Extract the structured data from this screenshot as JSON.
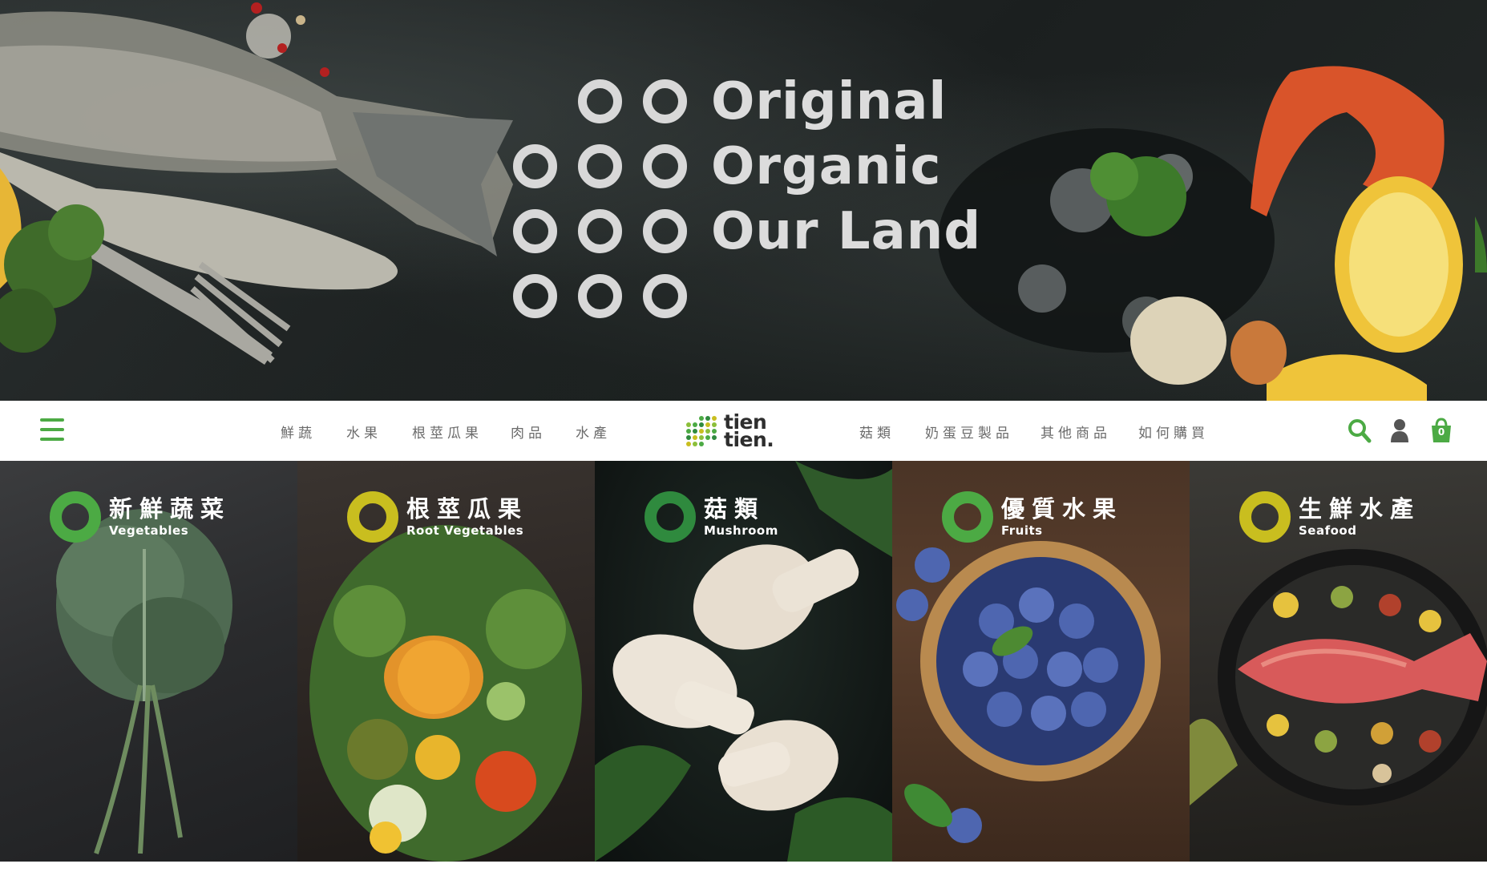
{
  "hero": {
    "taglines": [
      "Original",
      "Organic",
      "Our Land"
    ]
  },
  "nav": {
    "menu_icon": "hamburger-menu-icon",
    "left_links": [
      "鮮蔬",
      "水果",
      "根莖瓜果",
      "肉品",
      "水產"
    ],
    "right_links": [
      "菇類",
      "奶蛋豆製品",
      "其他商品",
      "如何購買"
    ],
    "logo_line1": "tien",
    "logo_line2": "tien.",
    "search_icon": "search-icon",
    "account_icon": "user-icon",
    "cart_icon": "shopping-bag-icon",
    "cart_count": "0",
    "accent_color": "#4caa44"
  },
  "categories": [
    {
      "zh": "新鮮蔬菜",
      "en": "Vegetables",
      "ring_color": "#4caa44"
    },
    {
      "zh": "根莖瓜果",
      "en": "Root Vegetables",
      "ring_color": "#c9be1f"
    },
    {
      "zh": "菇類",
      "en": "Mushroom",
      "ring_color": "#2f8a3e"
    },
    {
      "zh": "優質水果",
      "en": "Fruits",
      "ring_color": "#4caa44"
    },
    {
      "zh": "生鮮水產",
      "en": "Seafood",
      "ring_color": "#c9be1f"
    }
  ]
}
